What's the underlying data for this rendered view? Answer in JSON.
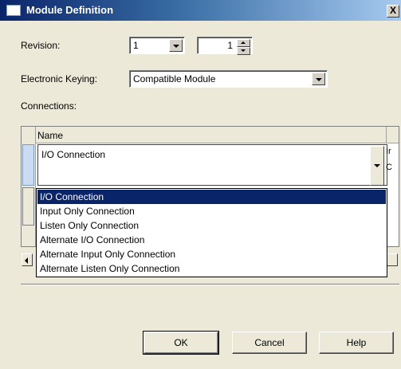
{
  "window": {
    "title": "Module Definition",
    "close_glyph": "X"
  },
  "revision": {
    "label": "Revision:",
    "major": "1",
    "minor": "1"
  },
  "keying": {
    "label": "Electronic Keying:",
    "value": "Compatible Module"
  },
  "connections": {
    "label": "Connections:",
    "column_header": "Name",
    "cell_value": "I/O Connection",
    "clipped_right_col": [
      "Ir",
      "C"
    ],
    "options": [
      "I/O Connection",
      "Input Only Connection",
      "Listen Only Connection",
      "Alternate I/O Connection",
      "Alternate Input Only Connection",
      "Alternate Listen Only Connection"
    ],
    "selected_option": "I/O Connection"
  },
  "buttons": {
    "ok": "OK",
    "cancel": "Cancel",
    "help": "Help"
  },
  "colors": {
    "titlebar": "#0a246a",
    "face": "#ece9d8",
    "highlight": "#0a246a"
  }
}
